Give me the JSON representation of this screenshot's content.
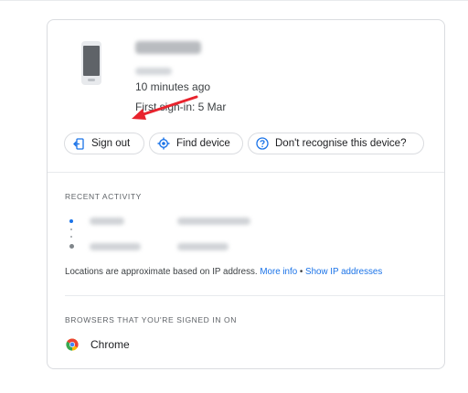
{
  "device": {
    "last_active": "10 minutes ago",
    "first_sign_in": "First sign-in: 5 Mar"
  },
  "actions": {
    "sign_out": "Sign out",
    "find_device": "Find device",
    "dont_recognise": "Don't recognise this device?"
  },
  "recent_activity": {
    "heading": "RECENT ACTIVITY",
    "note_prefix": "Locations are approximate based on IP address.",
    "more_info": "More info",
    "separator": " • ",
    "show_ip": "Show IP addresses"
  },
  "browsers": {
    "heading": "BROWSERS THAT YOU'RE SIGNED IN ON",
    "items": [
      {
        "name": "Chrome",
        "icon": "chrome-icon"
      }
    ]
  },
  "colors": {
    "accent": "#1a73e8",
    "annotation_arrow": "#e8232d"
  }
}
